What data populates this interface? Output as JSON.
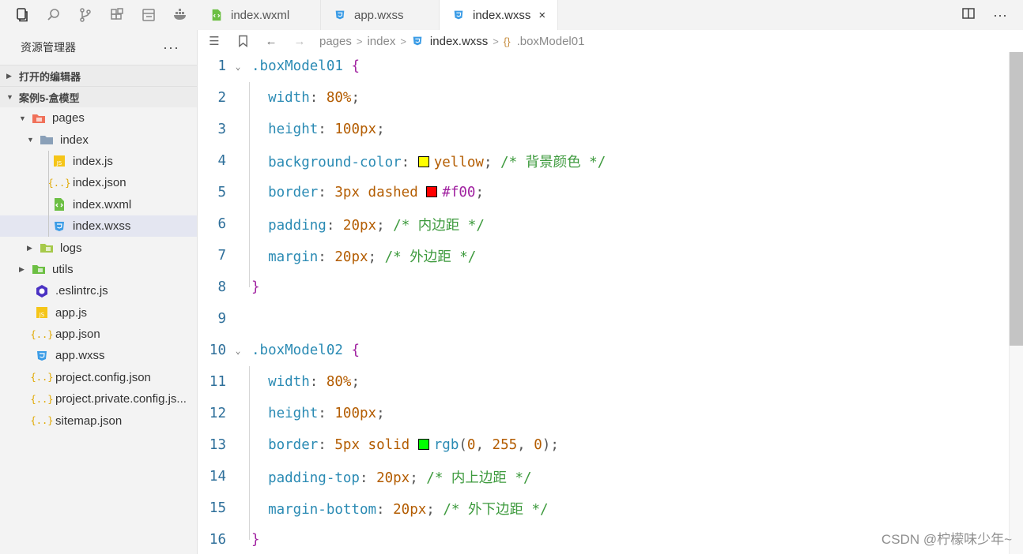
{
  "activity_bar": {
    "icons": [
      "explorer-icon",
      "search-icon",
      "source-control-icon",
      "extensions-icon",
      "outline-icon",
      "docker-icon"
    ]
  },
  "sidebar": {
    "title": "资源管理器",
    "more": "···",
    "section_open_editors": "打开的编辑器",
    "section_project": "案例5-盒模型",
    "tree": [
      {
        "label": "pages"
      },
      {
        "label": "index"
      },
      {
        "label": "index.js"
      },
      {
        "label": "index.json"
      },
      {
        "label": "index.wxml"
      },
      {
        "label": "index.wxss"
      },
      {
        "label": "logs"
      },
      {
        "label": "utils"
      },
      {
        "label": ".eslintrc.js"
      },
      {
        "label": "app.js"
      },
      {
        "label": "app.json"
      },
      {
        "label": "app.wxss"
      },
      {
        "label": "project.config.json"
      },
      {
        "label": "project.private.config.js..."
      },
      {
        "label": "sitemap.json"
      }
    ]
  },
  "tabs": [
    {
      "label": "index.wxml"
    },
    {
      "label": "app.wxss"
    },
    {
      "label": "index.wxss",
      "close": "×"
    }
  ],
  "breadcrumb": {
    "items": [
      "pages",
      "index",
      "index.wxss",
      ".boxModel01"
    ],
    "sep": ">"
  },
  "editor": {
    "line_numbers": [
      "1",
      "2",
      "3",
      "4",
      "5",
      "6",
      "7",
      "8",
      "9",
      "10",
      "11",
      "12",
      "13",
      "14",
      "15",
      "16"
    ],
    "code": {
      "l1": {
        "selector": ".boxModel01",
        "brace": "{"
      },
      "l2": {
        "prop": "width",
        "value": "80%"
      },
      "l3": {
        "prop": "height",
        "value": "100px"
      },
      "l4": {
        "prop": "background-color",
        "value": "yellow",
        "comment": "/* 背景颜色 */",
        "swatch": "#ffff00"
      },
      "l5": {
        "prop": "border",
        "value1": "3px",
        "value2": "dashed",
        "hex": "#f00",
        "swatch": "#ff0000"
      },
      "l6": {
        "prop": "padding",
        "value": "20px",
        "comment": "/* 内边距 */"
      },
      "l7": {
        "prop": "margin",
        "value": "20px",
        "comment": "/* 外边距 */"
      },
      "l8": {
        "brace": "}"
      },
      "l10": {
        "selector": ".boxModel02",
        "brace": "{"
      },
      "l11": {
        "prop": "width",
        "value": "80%"
      },
      "l12": {
        "prop": "height",
        "value": "100px"
      },
      "l13": {
        "prop": "border",
        "value1": "5px",
        "value2": "solid",
        "fn": "rgb",
        "a": "0",
        "b": "255",
        "c": "0",
        "swatch": "#00ff00"
      },
      "l14": {
        "prop": "padding-top",
        "value": "20px",
        "comment": "/* 内上边距 */"
      },
      "l15": {
        "prop": "margin-bottom",
        "value": "20px",
        "comment": "/* 外下边距 */"
      },
      "l16": {
        "brace": "}"
      }
    }
  },
  "watermark": "CSDN @柠檬味少年~"
}
